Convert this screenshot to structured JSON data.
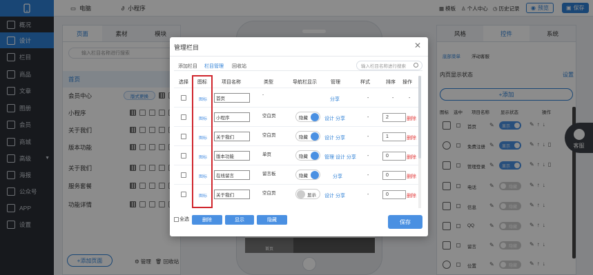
{
  "rail": {
    "items": [
      {
        "label": "概况",
        "icon": "chart-icon"
      },
      {
        "label": "设计",
        "icon": "design-icon"
      },
      {
        "label": "栏目",
        "icon": "column-icon"
      },
      {
        "label": "商品",
        "icon": "product-icon"
      },
      {
        "label": "文章",
        "icon": "article-icon"
      },
      {
        "label": "图册",
        "icon": "album-icon"
      },
      {
        "label": "会员",
        "icon": "member-icon"
      },
      {
        "label": "商城",
        "icon": "mall-icon"
      },
      {
        "label": "高级",
        "icon": "advanced-icon"
      },
      {
        "label": "海报",
        "icon": "poster-icon"
      },
      {
        "label": "公众号",
        "icon": "wechat-icon"
      },
      {
        "label": "APP",
        "icon": "app-icon"
      },
      {
        "label": "设置",
        "icon": "settings-icon"
      }
    ]
  },
  "topbar": {
    "tab_pc": "电脑",
    "tab_mini": "小程序",
    "template": "模板",
    "user_center": "个人中心",
    "history": "历史记录",
    "preview": "预览",
    "save": "保存"
  },
  "left_panel": {
    "tabs": [
      "页面",
      "素材",
      "模块"
    ],
    "search_placeholder": "输入栏目名称进行搜索",
    "rows": [
      "首页",
      "会员中心",
      "小程序",
      "关于我们",
      "版本功能",
      "关于我们",
      "服务套餐",
      "功能详情"
    ],
    "style_change": "版式更换",
    "add_page": "+添加页面",
    "manage": "管理",
    "recycle": "回收站"
  },
  "phone": {
    "home": "首页"
  },
  "right_panel": {
    "tabs": [
      "风格",
      "控件",
      "系统"
    ],
    "subtabs": [
      "底部菜单",
      "浮动客服"
    ],
    "title": "内页显示状态",
    "setting": "设置",
    "add": "+添加",
    "headers": [
      "图标",
      "选中",
      "项目名称",
      "显示状态",
      "操作"
    ],
    "rows": [
      {
        "name": "首页",
        "state": "显示",
        "on": true
      },
      {
        "name": "免费注册",
        "state": "显示",
        "on": true
      },
      {
        "name": "管理登录",
        "state": "显示",
        "on": true
      },
      {
        "name": "电话",
        "state": "隐藏",
        "on": false
      },
      {
        "name": "信息",
        "state": "隐藏",
        "on": false
      },
      {
        "name": "QQ",
        "state": "隐藏",
        "on": false
      },
      {
        "name": "留言",
        "state": "隐藏",
        "on": false
      },
      {
        "name": "位置",
        "state": "隐藏",
        "on": false
      }
    ]
  },
  "kefu": "客服",
  "modal": {
    "title": "管理栏目",
    "tabs": [
      "添加栏目",
      "栏目管理",
      "回收站"
    ],
    "search_placeholder": "输入栏目名称进行搜索",
    "headers": [
      "选择",
      "图标",
      "项目名称",
      "类型",
      "导航栏显示",
      "管理",
      "样式",
      "排序",
      "操作"
    ],
    "icon_link": "图标",
    "rows": [
      {
        "name": "首页",
        "type": "-",
        "nav": "",
        "mgmt": "分享",
        "style": "-",
        "order": "-",
        "op": "-"
      },
      {
        "name": "小程序",
        "type": "空白页",
        "nav": "隐藏",
        "mgmt": "设计 分享",
        "style": "-",
        "order": "2",
        "op": "删除"
      },
      {
        "name": "关于我们",
        "type": "空白页",
        "nav": "隐藏",
        "mgmt": "设计 分享",
        "style": "-",
        "order": "1",
        "op": "删除"
      },
      {
        "name": "版本功能",
        "type": "单页",
        "nav": "隐藏",
        "mgmt": "管理 设计 分享",
        "style": "-",
        "order": "0",
        "op": "删除"
      },
      {
        "name": "在线留言",
        "type": "留言板",
        "nav": "隐藏",
        "mgmt": "分享",
        "style": "-",
        "order": "0",
        "op": "删除"
      },
      {
        "name": "关于我们",
        "type": "空白页",
        "nav": "显示",
        "mgmt": "设计 分享",
        "style": "-",
        "order": "0",
        "op": "删除"
      }
    ],
    "select_all": "全选",
    "btn_delete": "删除",
    "btn_show": "显示",
    "btn_hide": "隐藏",
    "btn_save": "保存"
  },
  "colors": {
    "accent": "#2f80d6",
    "highlight_box": "#d0252c",
    "danger": "#e23b3b"
  }
}
